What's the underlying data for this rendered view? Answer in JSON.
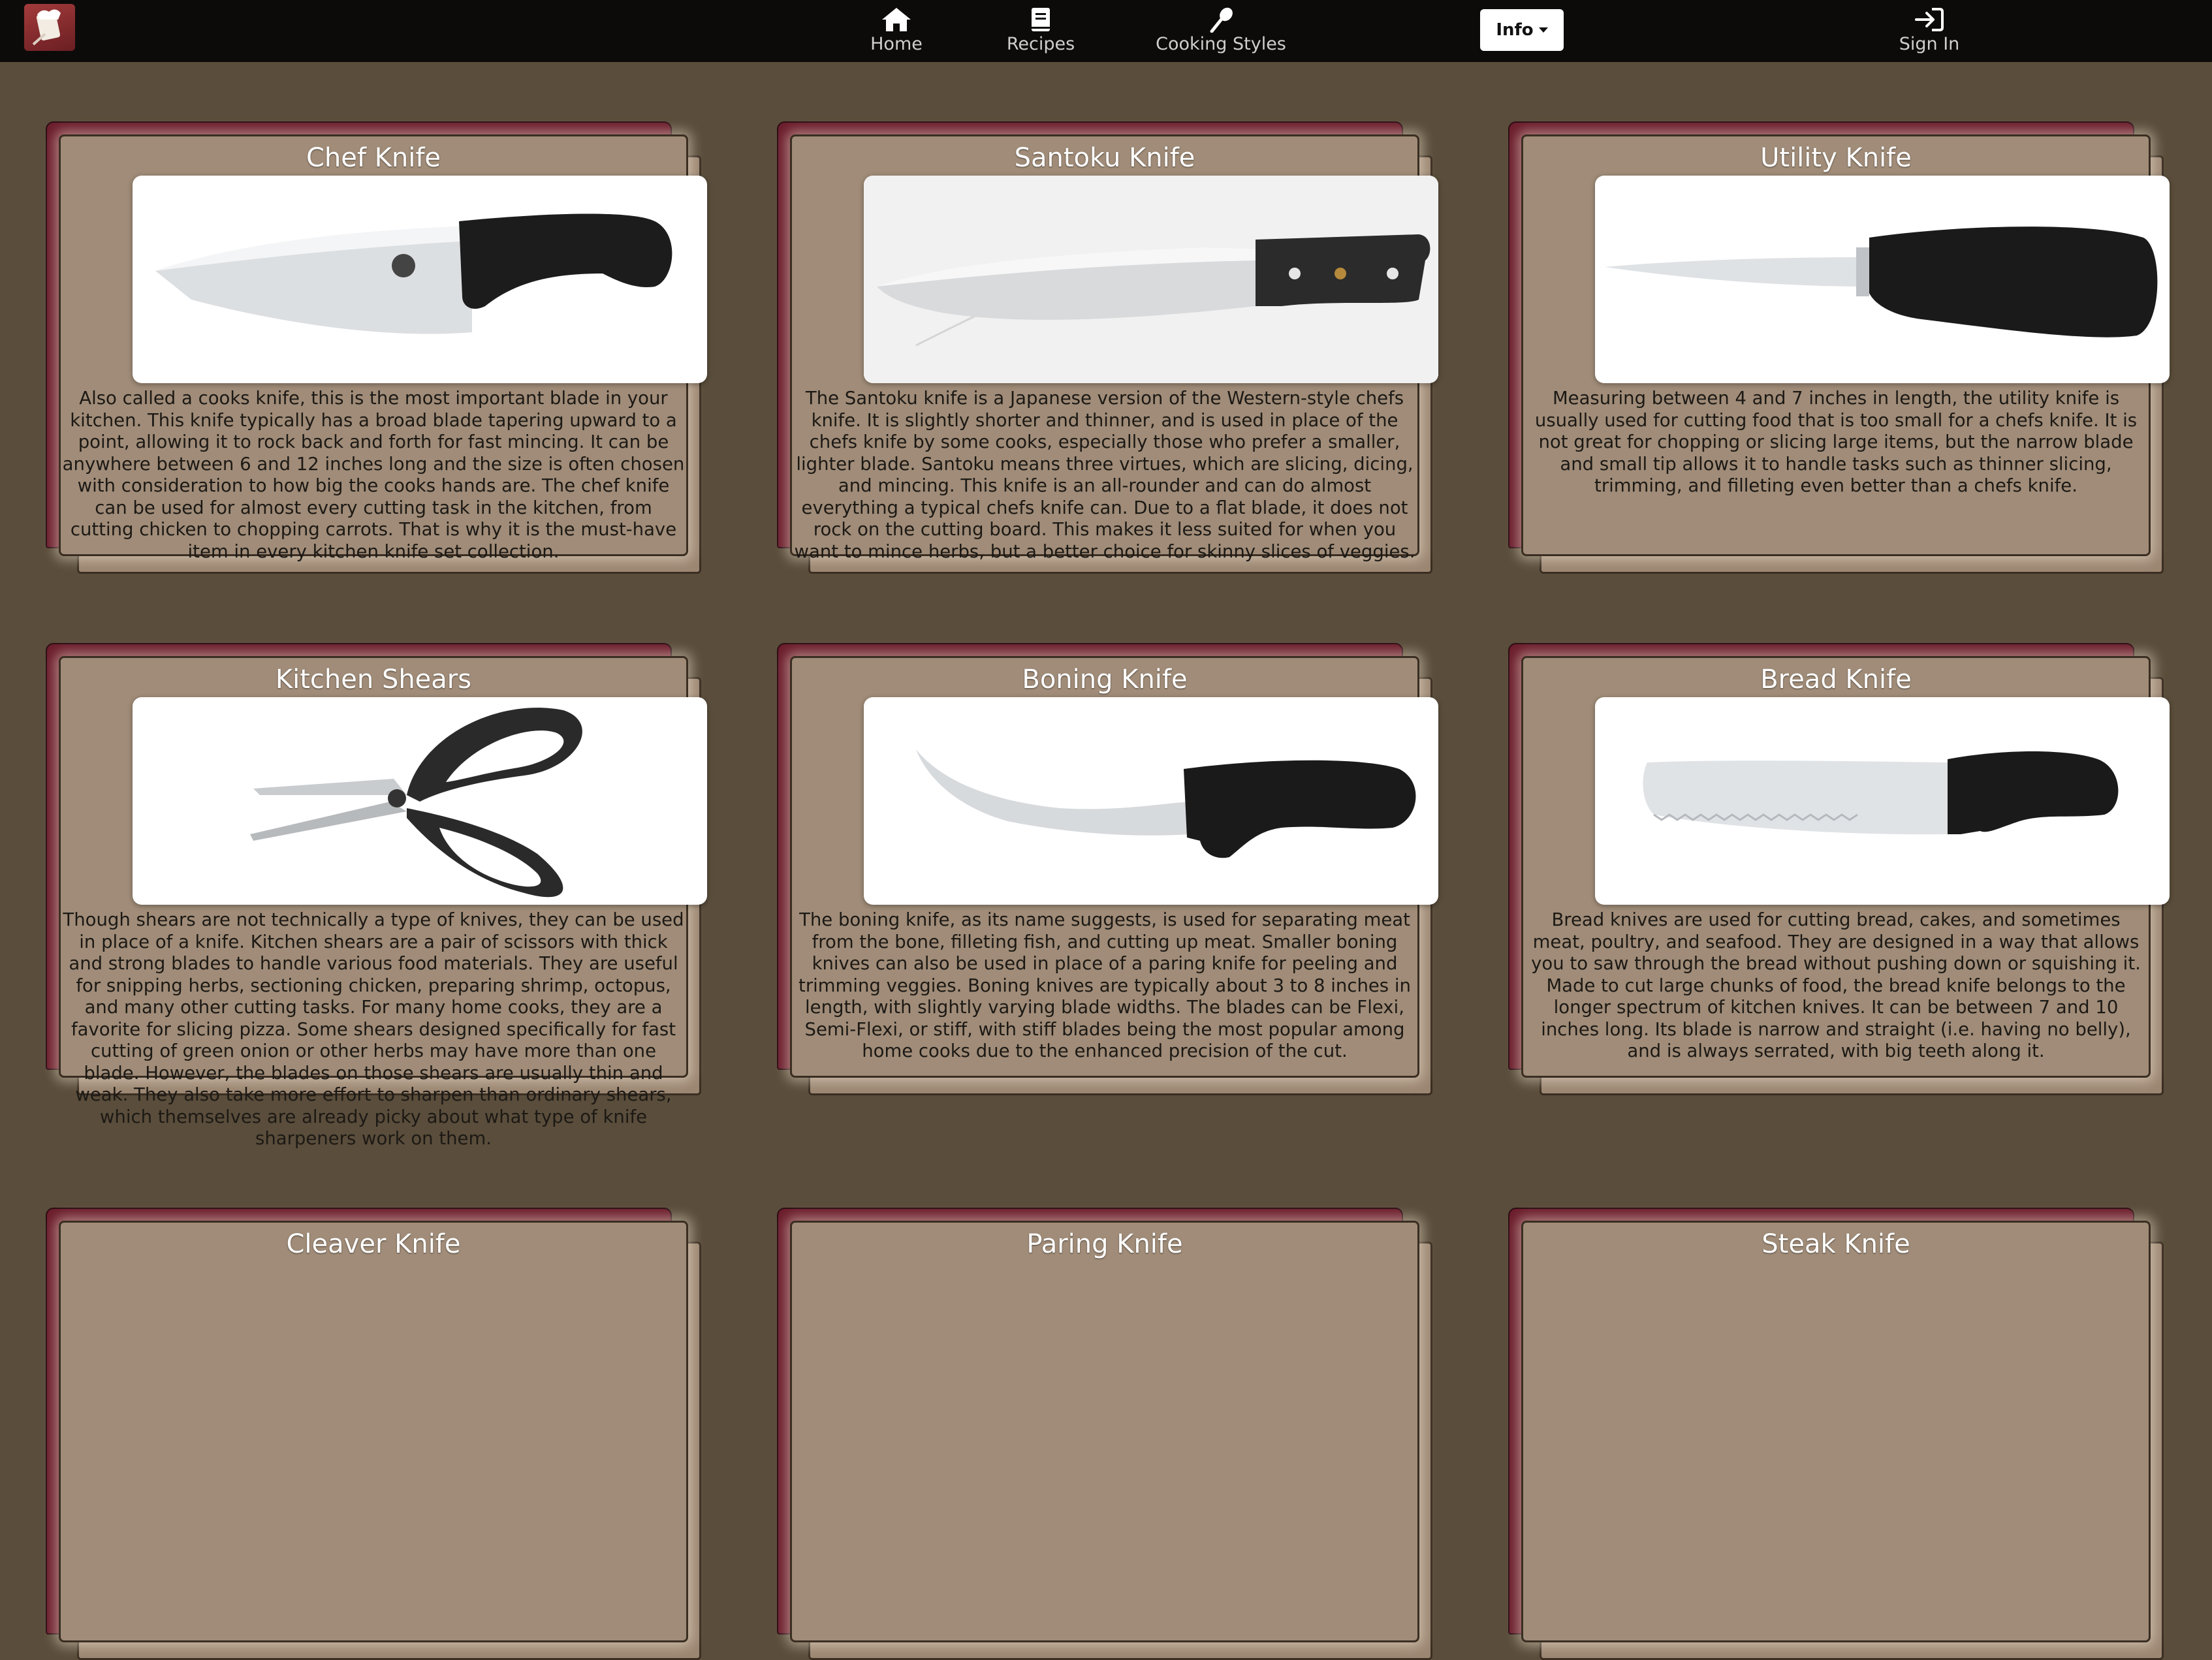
{
  "nav": {
    "home": "Home",
    "recipes": "Recipes",
    "cooking_styles": "Cooking Styles",
    "info": "Info",
    "sign_in": "Sign In"
  },
  "colors": {
    "background": "#5a4d3b",
    "navbar": "#0d0b09",
    "card_back": "#6b1d2c",
    "card_front": "#a08c78"
  },
  "cards": [
    {
      "title": "Chef Knife",
      "image": "chef-knife-image",
      "description": "Also called a cooks knife, this is the most important blade in your kitchen. This knife typically has a broad blade tapering upward to a point, allowing it to rock back and forth for fast mincing. It can be anywhere between 6 and 12 inches long and the size is often chosen with consideration to how big the cooks hands are. The chef knife can be used for almost every cutting task in the kitchen, from cutting chicken to chopping carrots. That is why it is the must-have item in every kitchen knife set collection."
    },
    {
      "title": "Santoku Knife",
      "image": "santoku-knife-image",
      "description": "The Santoku knife is a Japanese version of the Western-style chefs knife. It is slightly shorter and thinner, and is used in place of the chefs knife by some cooks, especially those who prefer a smaller, lighter blade. Santoku means three virtues, which are slicing, dicing, and mincing. This knife is an all-rounder and can do almost everything a typical chefs knife can. Due to a flat blade, it does not rock on the cutting board. This makes it less suited for when you want to mince herbs, but a better choice for skinny slices of veggies."
    },
    {
      "title": "Utility Knife",
      "image": "utility-knife-image",
      "description": "Measuring between 4 and 7 inches in length, the utility knife is usually used for cutting food that is too small for a chefs knife. It is not great for chopping or slicing large items, but the narrow blade and small tip allows it to handle tasks such as thinner slicing, trimming, and filleting even better than a chefs knife."
    },
    {
      "title": "Kitchen Shears",
      "image": "kitchen-shears-image",
      "description": "Though shears are not technically a type of knives, they can be used in place of a knife. Kitchen shears are a pair of scissors with thick and strong blades to handle various food materials. They are useful for snipping herbs, sectioning chicken, preparing shrimp, octopus, and many other cutting tasks. For many home cooks, they are a favorite for slicing pizza. Some shears designed specifically for fast cutting of green onion or other herbs may have more than one blade. However, the blades on those shears are usually thin and weak. They also take more effort to sharpen than ordinary shears, which themselves are already picky about what type of knife sharpeners work on them."
    },
    {
      "title": "Boning Knife",
      "image": "boning-knife-image",
      "description": "The boning knife, as its name suggests, is used for separating meat from the bone, filleting fish, and cutting up meat. Smaller boning knives can also be used in place of a paring knife for peeling and trimming veggies. Boning knives are typically about 3 to 8 inches in length, with slightly varying blade widths. The blades can be Flexi, Semi-Flexi, or stiff, with stiff blades being the most popular among home cooks due to the enhanced precision of the cut."
    },
    {
      "title": "Bread Knife",
      "image": "bread-knife-image",
      "description": "Bread knives are used for cutting bread, cakes, and sometimes meat, poultry, and seafood. They are designed in a way that allows you to saw through the bread without pushing down or squishing it. Made to cut large chunks of food, the bread knife belongs to the longer spectrum of kitchen knives. It can be between 7 and 10 inches long. Its blade is narrow and straight (i.e. having no belly), and is always serrated, with big teeth along it."
    },
    {
      "title": "Cleaver Knife"
    },
    {
      "title": "Paring Knife"
    },
    {
      "title": "Steak Knife"
    }
  ]
}
